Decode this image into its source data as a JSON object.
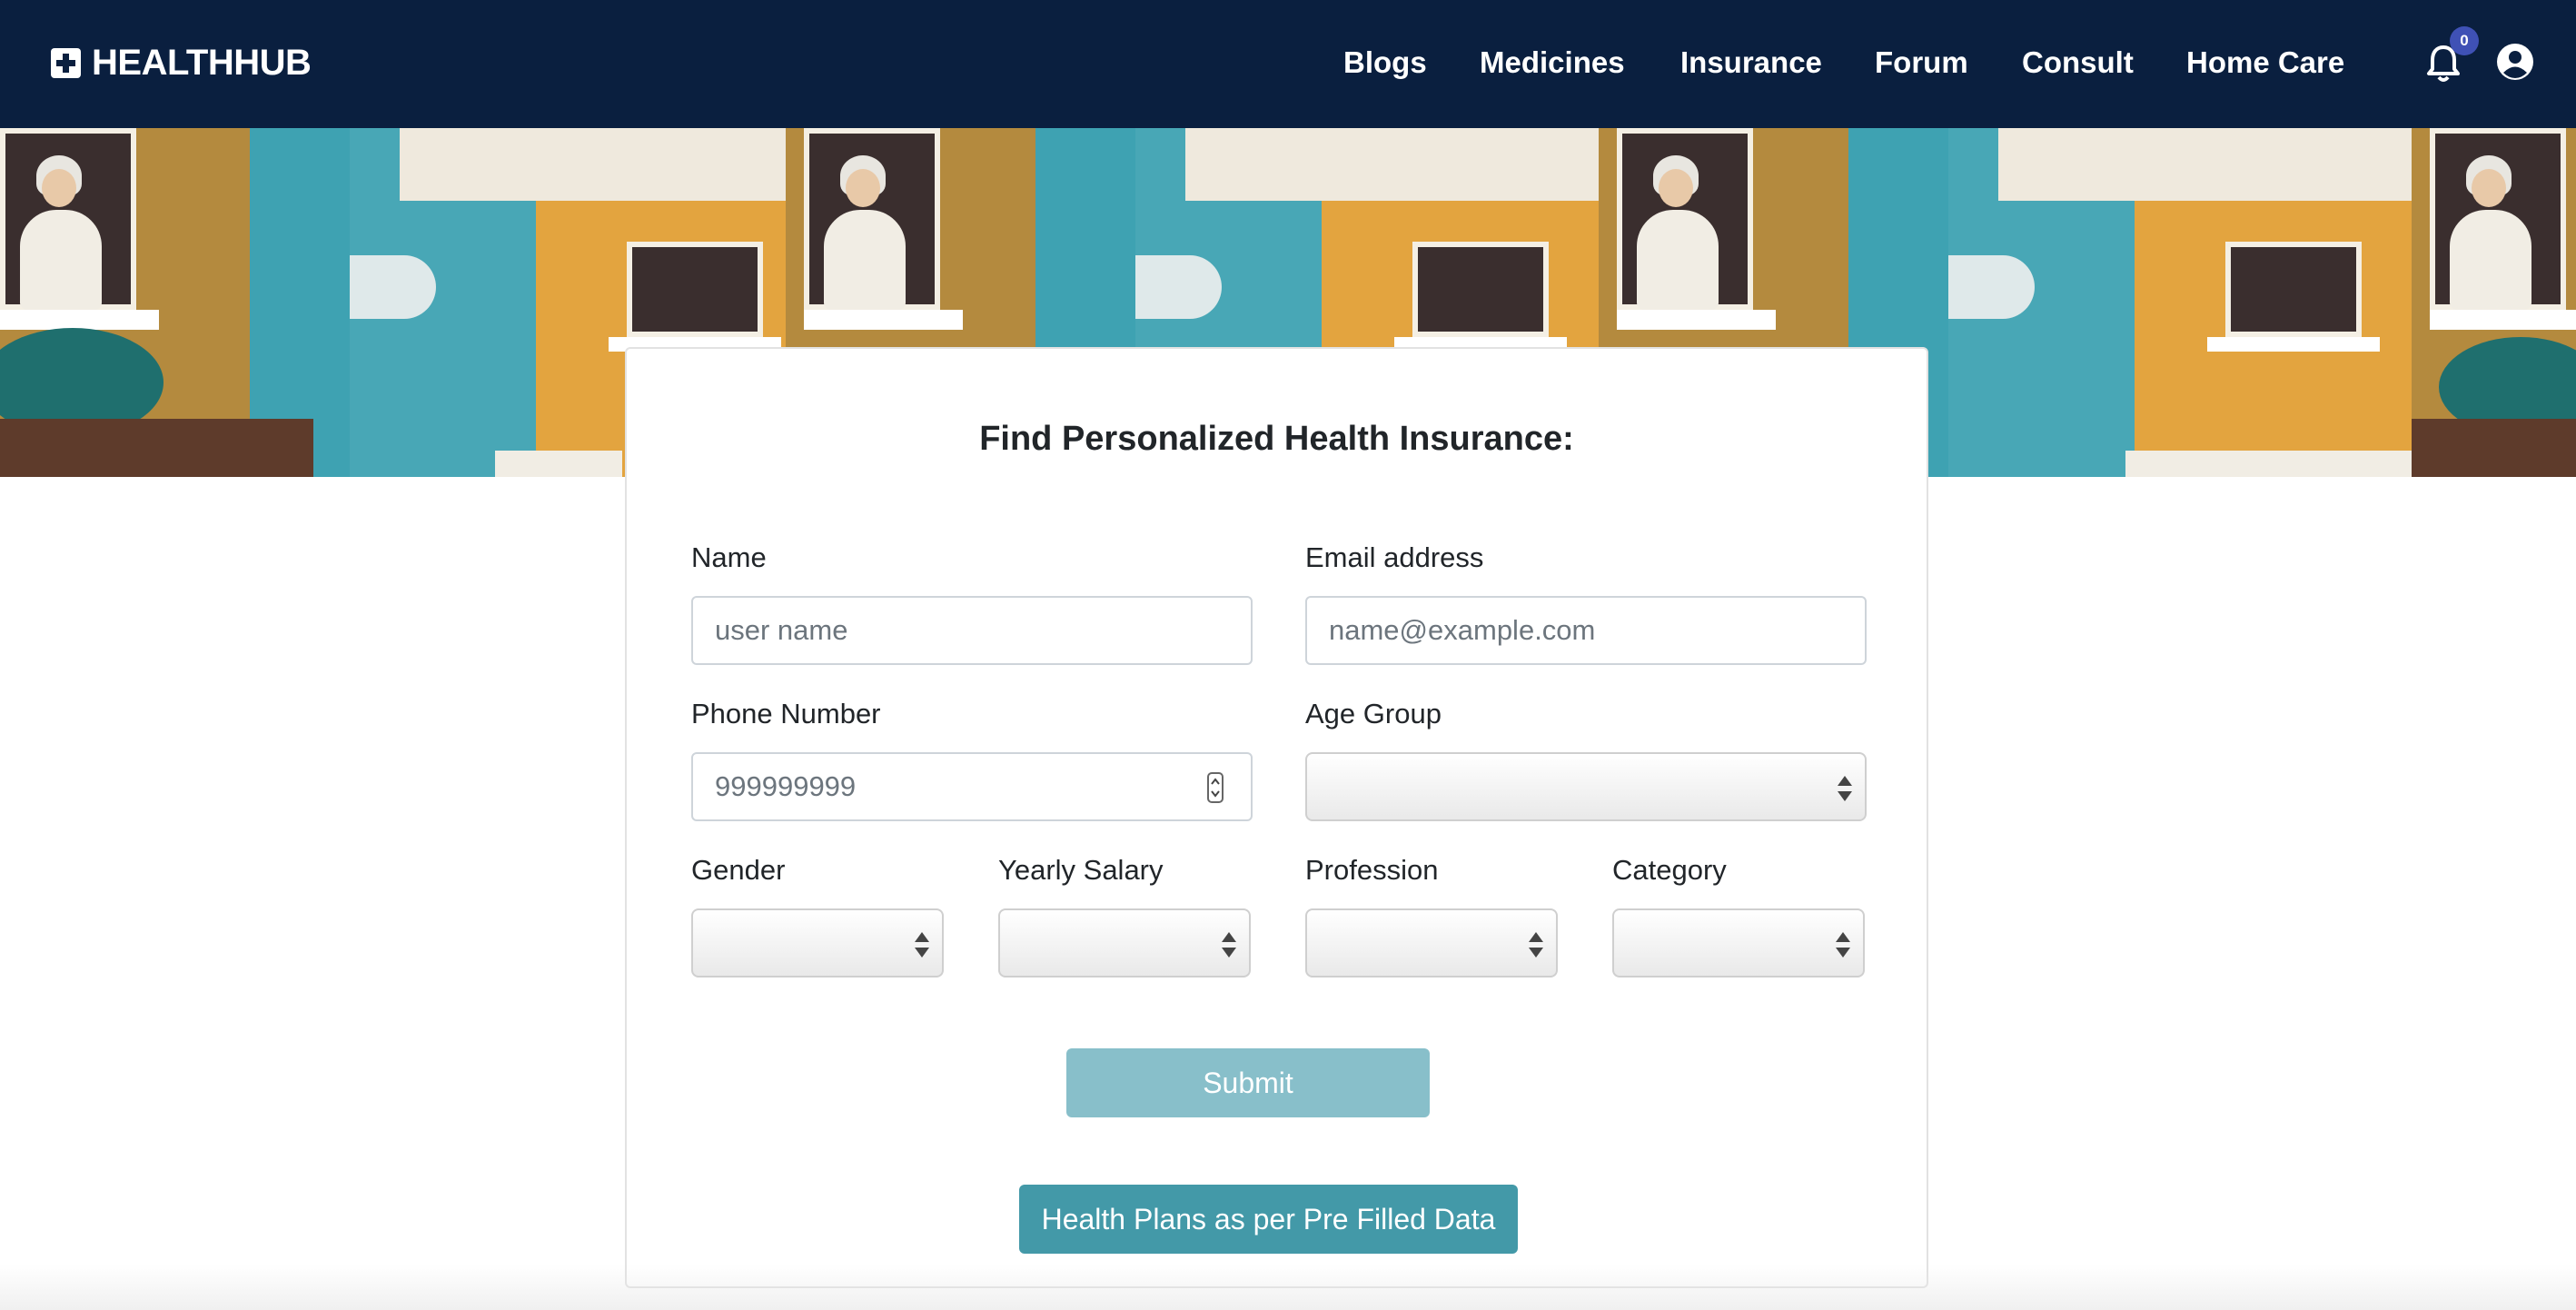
{
  "navbar": {
    "brand": "HEALTHHUB",
    "links": [
      "Blogs",
      "Medicines",
      "Insurance",
      "Forum",
      "Consult",
      "Home Care"
    ],
    "notification_count": "0",
    "colors": {
      "background": "#0a1f3f",
      "badge": "#3f51b5"
    }
  },
  "hero": {
    "description_icons": [
      "building-illustration"
    ]
  },
  "form": {
    "title": "Find Personalized Health Insurance:",
    "name_label": "Name",
    "name_placeholder": "user name",
    "email_label": "Email address",
    "email_placeholder": "name@example.com",
    "phone_label": "Phone Number",
    "phone_placeholder": "999999999",
    "age_label": "Age Group",
    "gender_label": "Gender",
    "salary_label": "Yearly Salary",
    "profession_label": "Profession",
    "category_label": "Category",
    "submit_label": "Submit",
    "prefilled_label": "Health Plans as per Pre Filled Data",
    "colors": {
      "submit": "#88bfca",
      "prefilled": "#4399a8"
    }
  }
}
